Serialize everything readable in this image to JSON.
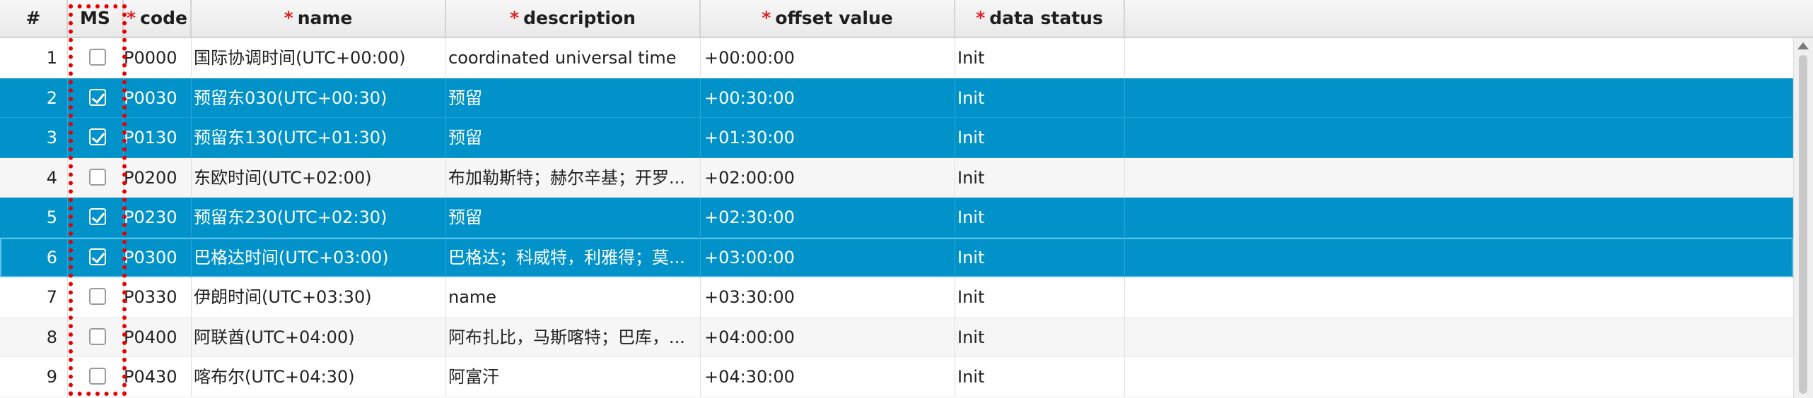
{
  "header": {
    "num": "#",
    "ms": "MS",
    "required_marker": "*",
    "code": "code",
    "name": "name",
    "description": "description",
    "offset": "offset value",
    "status": "data status"
  },
  "rows": [
    {
      "num": "1",
      "checked": false,
      "code": "P0000",
      "name": "国际协调时间(UTC+00:00)",
      "description": "coordinated universal time",
      "offset": "+00:00:00",
      "status": "Init",
      "selected": false
    },
    {
      "num": "2",
      "checked": true,
      "code": "P0030",
      "name": "预留东030(UTC+00:30)",
      "description": "预留",
      "offset": "+00:30:00",
      "status": "Init",
      "selected": true
    },
    {
      "num": "3",
      "checked": true,
      "code": "P0130",
      "name": "预留东130(UTC+01:30)",
      "description": "预留",
      "offset": "+01:30:00",
      "status": "Init",
      "selected": true
    },
    {
      "num": "4",
      "checked": false,
      "code": "P0200",
      "name": "东欧时间(UTC+02:00)",
      "description": "布加勒斯特；赫尔辛基；开罗...",
      "offset": "+02:00:00",
      "status": "Init",
      "selected": false
    },
    {
      "num": "5",
      "checked": true,
      "code": "P0230",
      "name": "预留东230(UTC+02:30)",
      "description": "预留",
      "offset": "+02:30:00",
      "status": "Init",
      "selected": true
    },
    {
      "num": "6",
      "checked": true,
      "code": "P0300",
      "name": "巴格达时间(UTC+03:00)",
      "description": "巴格达；科威特，利雅得；莫...",
      "offset": "+03:00:00",
      "status": "Init",
      "selected": true
    },
    {
      "num": "7",
      "checked": false,
      "code": "P0330",
      "name": "伊朗时间(UTC+03:30)",
      "description": "name",
      "offset": "+03:30:00",
      "status": "Init",
      "selected": false
    },
    {
      "num": "8",
      "checked": false,
      "code": "P0400",
      "name": "阿联酋(UTC+04:00)",
      "description": "阿布扎比，马斯喀特；巴库，...",
      "offset": "+04:00:00",
      "status": "Init",
      "selected": false
    },
    {
      "num": "9",
      "checked": false,
      "code": "P0430",
      "name": "喀布尔(UTC+04:30)",
      "description": "阿富汗",
      "offset": "+04:30:00",
      "status": "Init",
      "selected": false
    }
  ],
  "colors": {
    "selected_row": "#0092c8",
    "highlight": "#e60000",
    "required_marker": "#e02020"
  },
  "icons": {
    "checkbox": "checkbox-icon",
    "scroll_up": "scroll-up-arrow-icon"
  }
}
